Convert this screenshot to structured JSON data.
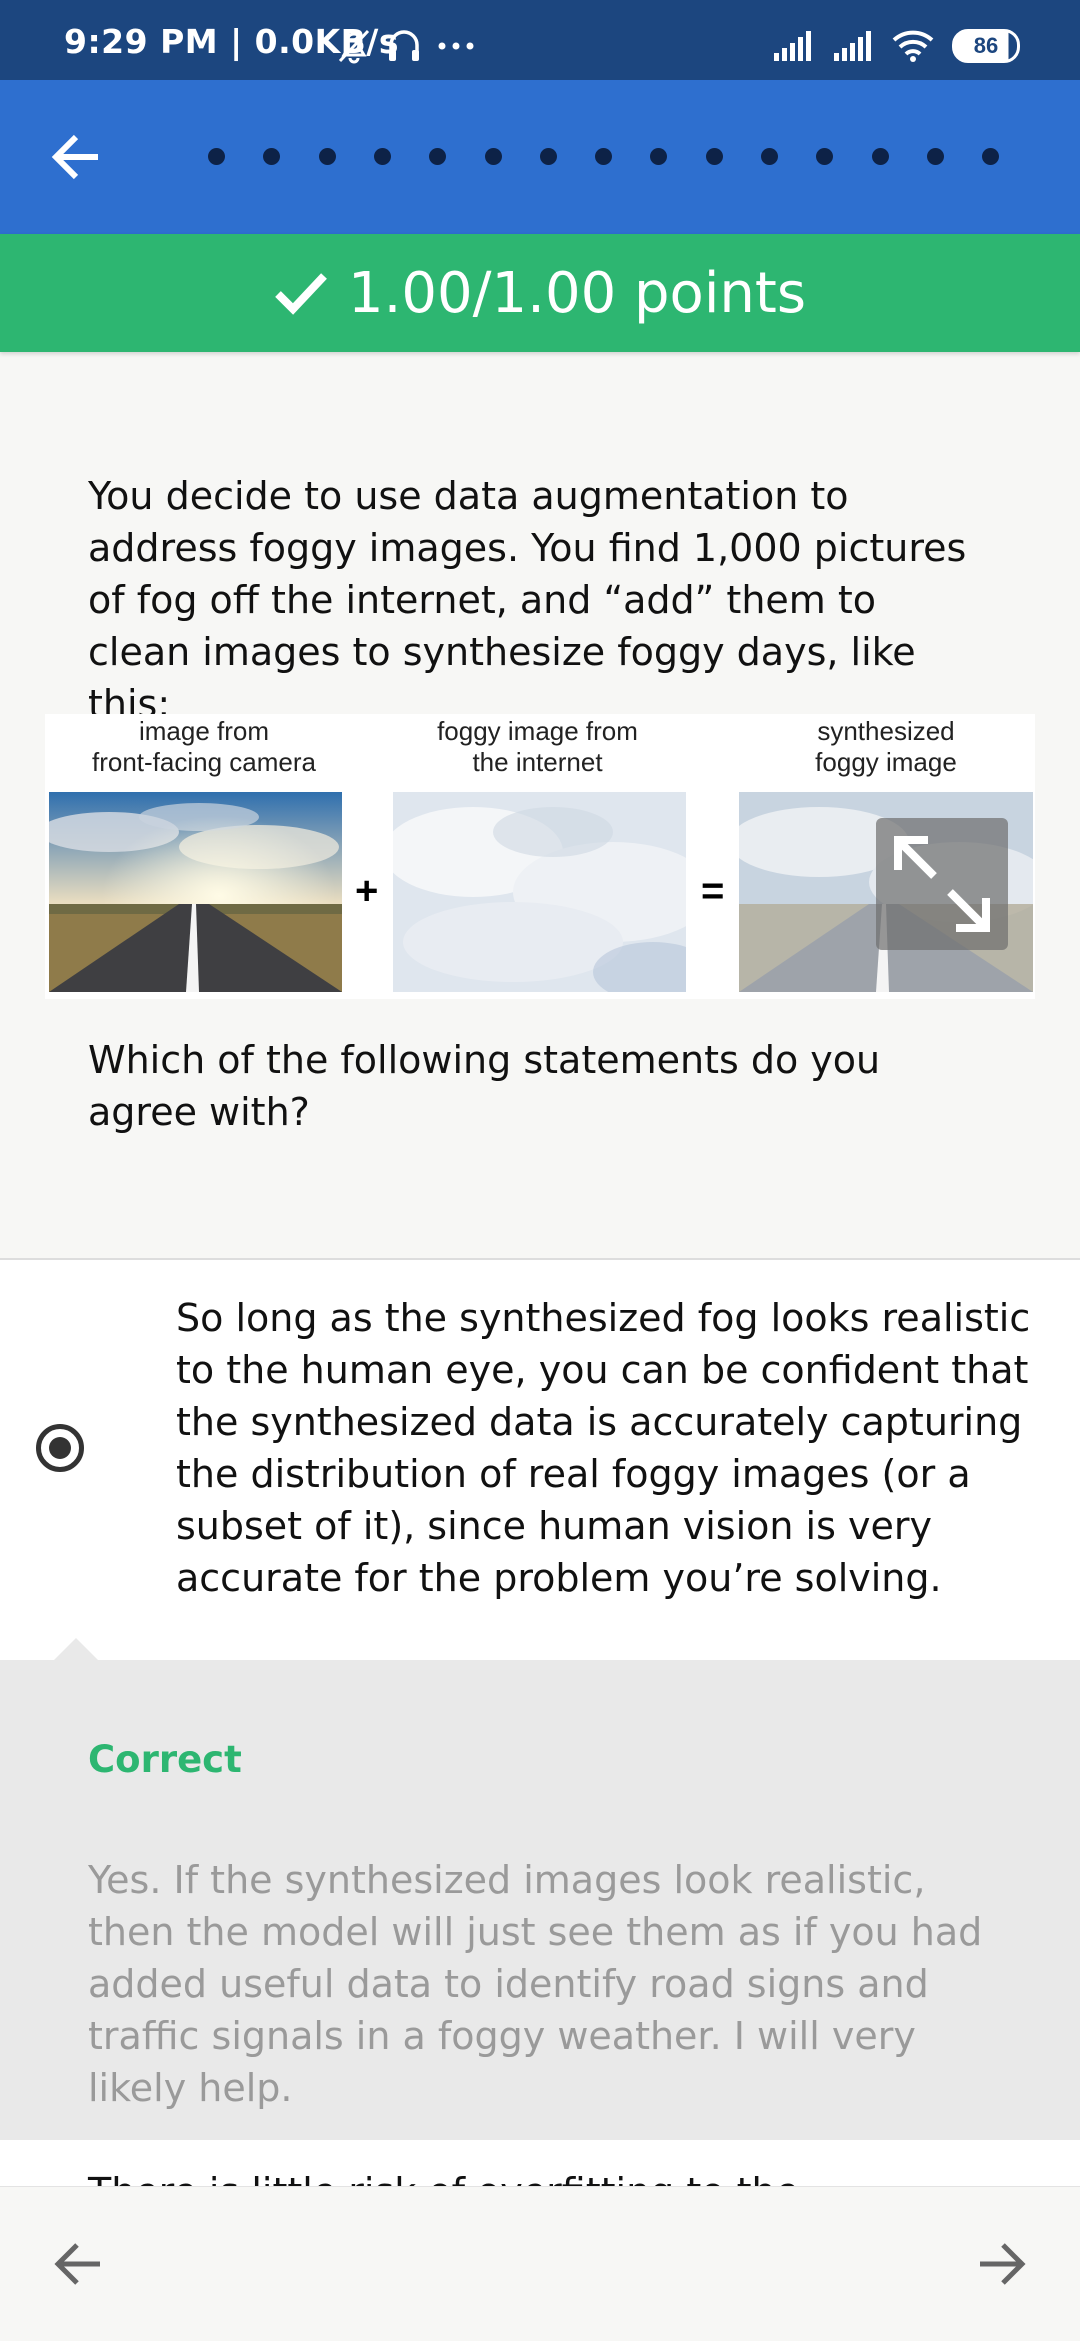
{
  "status_bar": {
    "time_speed": "9:29 PM | 0.0KB/s",
    "battery": "86"
  },
  "app_bar": {
    "back_icon": "arrow-left-icon",
    "progress_dot_count": 15
  },
  "score": {
    "text": "1.00/1.00 points",
    "icon": "checkmark-icon"
  },
  "question": {
    "text": "You decide to use data augmentation to address foggy images. You find 1,000 pictures of fog off the internet, and “add” them to clean images to synthesize foggy days, like this:",
    "prompt": "Which of the following statements do you agree with?"
  },
  "figure": {
    "caption_1": "image from\nfront-facing camera",
    "caption_2": "foggy image from\nthe internet",
    "caption_3": "synthesized\nfoggy image",
    "plus": "+",
    "equals": "=",
    "expand_icon": "expand-icon"
  },
  "option": {
    "selected": true,
    "text": "So long as the synthesized fog looks realistic to the human eye, you can be confident that the synthesized data is accurately capturing the distribution of real foggy images (or a subset of it), since human vision is very accurate for the problem you’re solving."
  },
  "feedback": {
    "label": "Correct",
    "text": "Yes. If the synthesized images look realistic, then the model will just see them as if you had added useful data to identify road signs and traffic signals in a foggy weather. I will very likely help."
  },
  "next_option_partial": "There is little risk of overfitting to the",
  "colors": {
    "status_bar": "#1c467f",
    "app_bar": "#2e6fcf",
    "success": "#2db671"
  },
  "bottom_nav": {
    "prev_icon": "arrow-left-icon",
    "next_icon": "arrow-right-icon"
  }
}
